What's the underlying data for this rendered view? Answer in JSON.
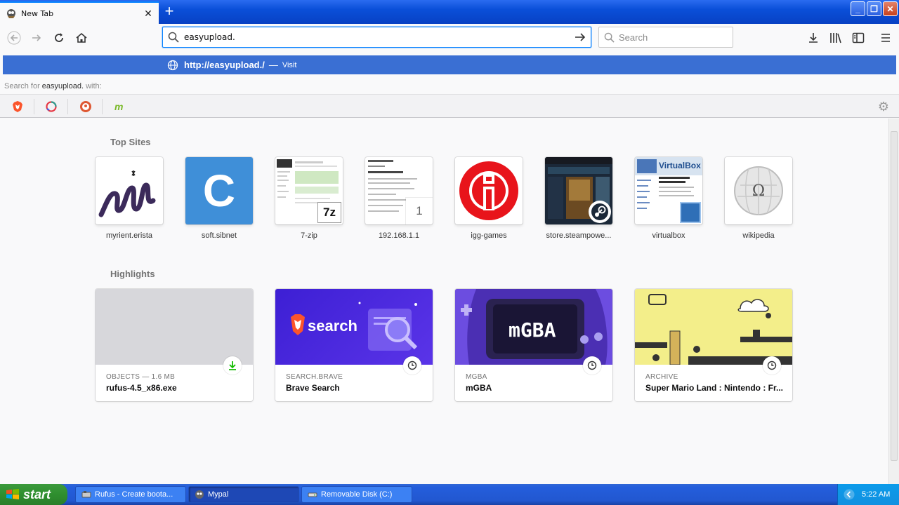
{
  "tab": {
    "title": "New Tab"
  },
  "urlbar": {
    "value": "easyupload."
  },
  "searchbar": {
    "placeholder": "Search"
  },
  "dropdown": {
    "visit_url": "http://easyupload./",
    "visit_sep": "—",
    "visit_label": "Visit",
    "search_for_prefix": "Search for",
    "search_for_query": "easyupload.",
    "search_for_suffix": "with:"
  },
  "top_sites": {
    "heading": "Top Sites",
    "items": [
      {
        "label": "myrient.erista"
      },
      {
        "label": "soft.sibnet"
      },
      {
        "label": "7-zip"
      },
      {
        "label": "192.168.1.1"
      },
      {
        "label": "igg-games"
      },
      {
        "label": "store.steampowe..."
      },
      {
        "label": "virtualbox"
      },
      {
        "label": "wikipedia"
      }
    ],
    "thumb_text": {
      "sibnet": "C",
      "sevenzip": "7z",
      "router_badge": "1",
      "vbox": "VirtualBox",
      "mgba": "mGBA",
      "wiki": "Ω"
    }
  },
  "highlights": {
    "heading": "Highlights",
    "items": [
      {
        "context": "OBJECTS — 1.6 MB",
        "title": "rufus-4.5_x86.exe"
      },
      {
        "context": "SEARCH.BRAVE",
        "title": "Brave Search",
        "image_text": "search"
      },
      {
        "context": "MGBA",
        "title": "mGBA",
        "image_text": "mGBA"
      },
      {
        "context": "ARCHIVE",
        "title": "Super Mario Land : Nintendo : Fr..."
      }
    ]
  },
  "taskbar": {
    "start_label": "start",
    "tasks": [
      {
        "label": "Rufus - Create boota..."
      },
      {
        "label": "Mypal"
      },
      {
        "label": "Removable Disk (C:)"
      }
    ],
    "clock": "5:22 AM"
  },
  "colors": {
    "accent": "#0a84ff",
    "visit_row": "#3a6fd3",
    "xp_blue": "#245edc",
    "xp_green": "#2f8f2f"
  }
}
